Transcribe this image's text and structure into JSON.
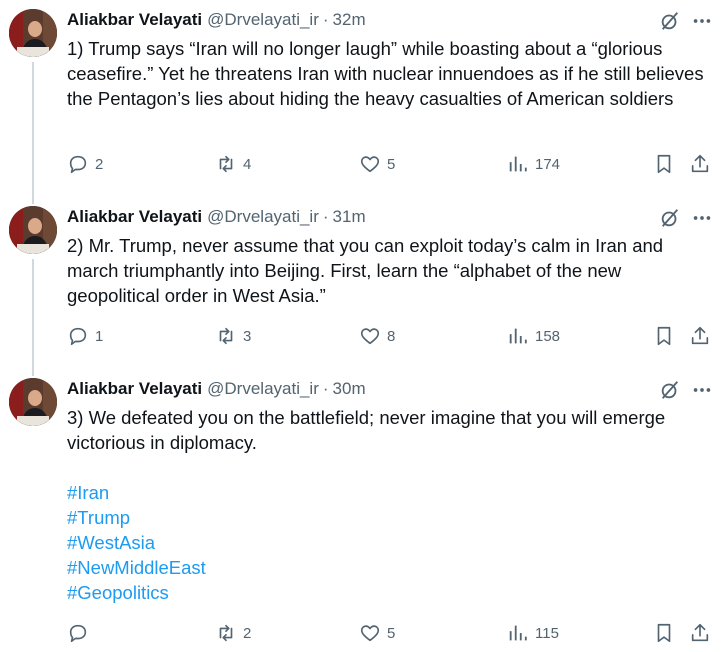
{
  "tweets": [
    {
      "author": "Aliakbar Velayati",
      "handle": "@Drvelayati_ir",
      "separator": "·",
      "time": "32m",
      "text": "1) Trump says “Iran will no longer laugh” while boasting about a “glorious ceasefire.” Yet he threatens Iran with nuclear innuendoes as if he still believes the Pentagon’s lies about hiding the heavy casualties of American soldiers",
      "hashtags": [],
      "replies": "2",
      "reposts": "4",
      "likes": "5",
      "views": "174"
    },
    {
      "author": "Aliakbar Velayati",
      "handle": "@Drvelayati_ir",
      "separator": "·",
      "time": "31m",
      "text": "2) Mr. Trump, never assume that you can exploit today’s calm in Iran and march triumphantly into Beijing. First, learn the “alphabet of the new geopolitical order in West Asia.”",
      "hashtags": [],
      "replies": "1",
      "reposts": "3",
      "likes": "8",
      "views": "158"
    },
    {
      "author": "Aliakbar Velayati",
      "handle": "@Drvelayati_ir",
      "separator": "·",
      "time": "30m",
      "text": "3) We defeated you on the battlefield; never imagine that you will emerge victorious in diplomacy.",
      "hashtags": [
        "#Iran",
        "#Trump",
        "#WestAsia",
        "#NewMiddleEast",
        "#Geopolitics"
      ],
      "replies": "",
      "reposts": "2",
      "likes": "5",
      "views": "115"
    }
  ],
  "icons": {
    "reply": "reply-icon",
    "repost": "repost-icon",
    "like": "like-icon",
    "views": "views-icon",
    "bookmark": "bookmark-icon",
    "share": "share-icon",
    "grok": "grok-icon",
    "more": "more-icon"
  },
  "colors": {
    "text": "#0f1419",
    "secondary": "#536471",
    "link": "#1d9bf0",
    "thread_line": "#cfd9de",
    "background": "#ffffff"
  }
}
